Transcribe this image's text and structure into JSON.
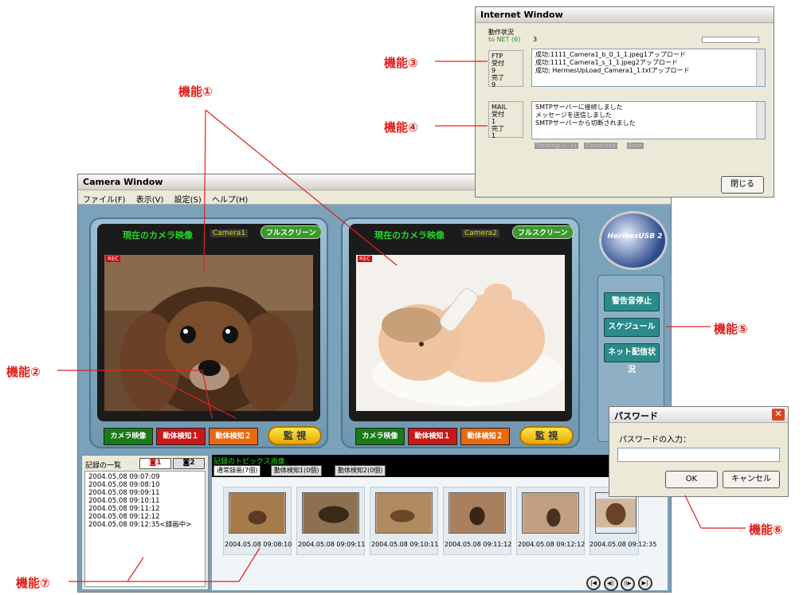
{
  "callouts": {
    "f1": "機能①",
    "f2": "機能②",
    "f3": "機能③",
    "f4": "機能④",
    "f5": "機能⑤",
    "f6": "機能⑥",
    "f7": "機能⑦"
  },
  "camera_window": {
    "title": "Camera Window",
    "menu": [
      "ファイル(F)",
      "表示(V)",
      "設定(S)",
      "ヘルプ(H)"
    ],
    "logo_text": "HermesUSB 2",
    "cameras": [
      {
        "header": "現在のカメラ映像",
        "name": "Camera1",
        "fullscreen": "フルスクリーン",
        "rec": "REC",
        "buttons": [
          "カメラ映像",
          "動体検知１",
          "動体検知２"
        ],
        "monitor": "監 視"
      },
      {
        "header": "現在のカメラ映像",
        "name": "Camera2",
        "fullscreen": "フルスクリーン",
        "rec": "REC",
        "buttons": [
          "カメラ映像",
          "動体検知１",
          "動体検知２"
        ],
        "monitor": "監 視"
      }
    ],
    "side_buttons": [
      "警告音停止",
      "スケジュール",
      "ネット配信状況"
    ],
    "log_title": "記録の一覧",
    "log_tabs": [
      "1",
      "2"
    ],
    "log_items": [
      "2004.05.08 09:07:09",
      "2004.05.08 09:08:10",
      "2004.05.08 09:09:11",
      "2004.05.08 09:10:11",
      "2004.05.08 09:11:12",
      "2004.05.08 09:12:12",
      "2004.05.08 09:12:35<録画中>"
    ],
    "topics_title": "記録のトピックス画像",
    "topic_tabs": [
      "通常録画(7個)",
      "動体検知1(0個)",
      "動体検知2(0個)"
    ],
    "thumbnails": [
      "2004.05.08 09:08:10",
      "2004.05.08 09:09:11",
      "2004.05.08 09:10:11",
      "2004.05.08 09:11:12",
      "2004.05.08 09:12:12",
      "2004.05.08 09:12:35"
    ],
    "playback": [
      "|◀",
      "◀||",
      "||▶",
      "▶|"
    ]
  },
  "internet_window": {
    "title": "Internet Window",
    "status_label": "動作状況",
    "to_net_label": "to NET (6)",
    "to_net_value": "3",
    "ftp": {
      "label": "FTP",
      "accept_label": "受付",
      "accept": "9",
      "done_label": "完了",
      "done": "9",
      "log": [
        "成功:1111_Camera1_b_0_1_1.jpeg1アップロード",
        "成功:1111_Camera1_s_1_1.jpeg2アップロード",
        "成功: HermesUpLoad_Camera1_1.txtアップロード"
      ]
    },
    "mail": {
      "label": "MAIL",
      "accept_label": "受付",
      "accept": "1",
      "done_label": "完了",
      "done": "1",
      "log": [
        "SMTPサーバーに接続しました",
        "メッセージを送信しました",
        "SMTPサーバーから切断されました"
      ]
    },
    "indicators": [
      "Sending(<-->)",
      "Connected",
      "Error"
    ],
    "close": "閉じる"
  },
  "password_dialog": {
    "title": "パスワード",
    "label": "パスワードの入力：",
    "value": "",
    "ok": "OK",
    "cancel": "キャンセル"
  }
}
